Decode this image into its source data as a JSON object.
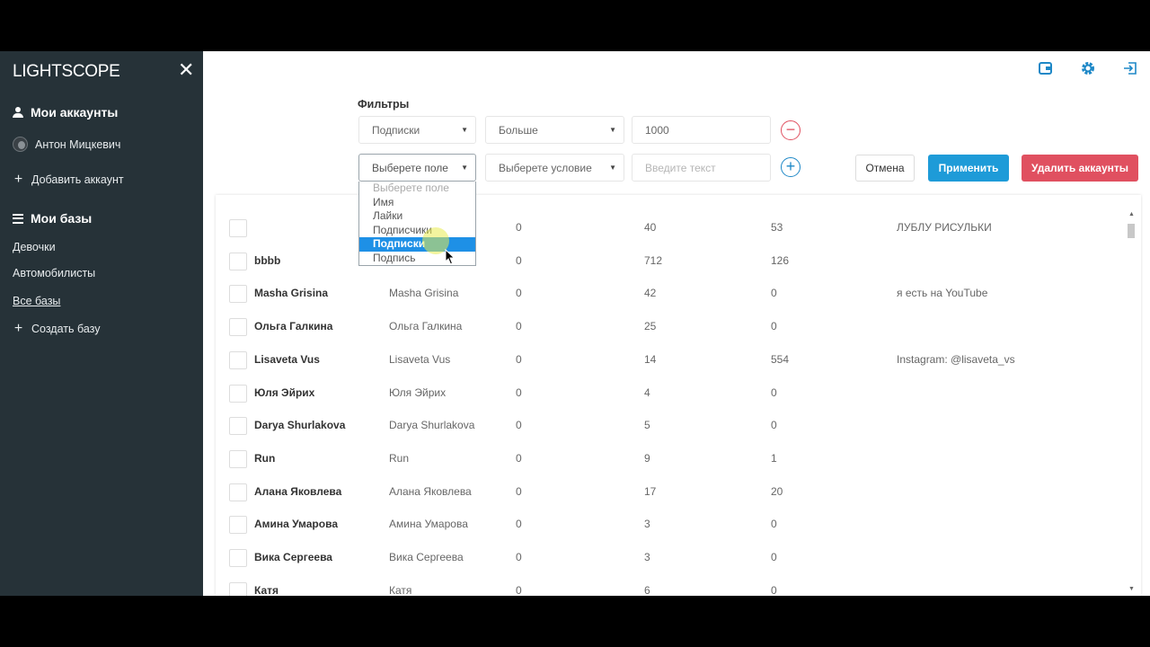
{
  "app": {
    "brand": "LIGHTSCOPE"
  },
  "sidebar": {
    "accounts_title": "Мои аккаунты",
    "account_name": "Антон Мицкевич",
    "add_account": "Добавить аккаунт",
    "bases_title": "Мои базы",
    "bases": [
      "Девочки",
      "Автомобилисты",
      "Все базы"
    ],
    "create_base": "Создать базу"
  },
  "filters": {
    "title": "Фильтры",
    "row1": {
      "field": "Подписки",
      "condition": "Больше",
      "value": "1000"
    },
    "row2": {
      "field_placeholder": "Выберете поле",
      "condition_placeholder": "Выберете условие",
      "text_placeholder": "Введите текст"
    },
    "cancel": "Отмена",
    "apply": "Применить",
    "delete": "Удалить аккаунты",
    "dropdown_options": [
      "Выберете поле",
      "Имя",
      "Лайки",
      "Подписчики",
      "Подписки",
      "Подпись"
    ],
    "dropdown_selected_index": 4
  },
  "colors": {
    "sidebar": "#263238",
    "primary": "#1e88c7",
    "danger": "#e05060",
    "selected": "#1e90e6"
  },
  "table": {
    "rows": [
      {
        "username": "",
        "name": "",
        "c3": "0",
        "c4": "40",
        "c5": "53",
        "bio": "ЛУБЛУ РИСУЛЬКИ"
      },
      {
        "username": "bbbb",
        "name": "",
        "c3": "0",
        "c4": "712",
        "c5": "126",
        "bio": ""
      },
      {
        "username": "Masha Grisina",
        "name": "Masha Grisina",
        "c3": "0",
        "c4": "42",
        "c5": "0",
        "bio": "я есть на YouTube"
      },
      {
        "username": "Ольга Галкина",
        "name": "Ольга Галкина",
        "c3": "0",
        "c4": "25",
        "c5": "0",
        "bio": ""
      },
      {
        "username": "Lisaveta Vus",
        "name": "Lisaveta Vus",
        "c3": "0",
        "c4": "14",
        "c5": "554",
        "bio": "Instagram: @lisaveta_vs"
      },
      {
        "username": "Юля Эйрих",
        "name": "Юля Эйрих",
        "c3": "0",
        "c4": "4",
        "c5": "0",
        "bio": ""
      },
      {
        "username": "Darya Shurlakova",
        "name": "Darya Shurlakova",
        "c3": "0",
        "c4": "5",
        "c5": "0",
        "bio": ""
      },
      {
        "username": "Run",
        "name": "Run",
        "c3": "0",
        "c4": "9",
        "c5": "1",
        "bio": ""
      },
      {
        "username": "Алана Яковлева",
        "name": "Алана Яковлева",
        "c3": "0",
        "c4": "17",
        "c5": "20",
        "bio": ""
      },
      {
        "username": "Амина Умарова",
        "name": "Амина Умарова",
        "c3": "0",
        "c4": "3",
        "c5": "0",
        "bio": ""
      },
      {
        "username": "Вика Сергеева",
        "name": "Вика Сергеева",
        "c3": "0",
        "c4": "3",
        "c5": "0",
        "bio": ""
      },
      {
        "username": "Катя",
        "name": "Катя",
        "c3": "0",
        "c4": "6",
        "c5": "0",
        "bio": ""
      }
    ]
  }
}
